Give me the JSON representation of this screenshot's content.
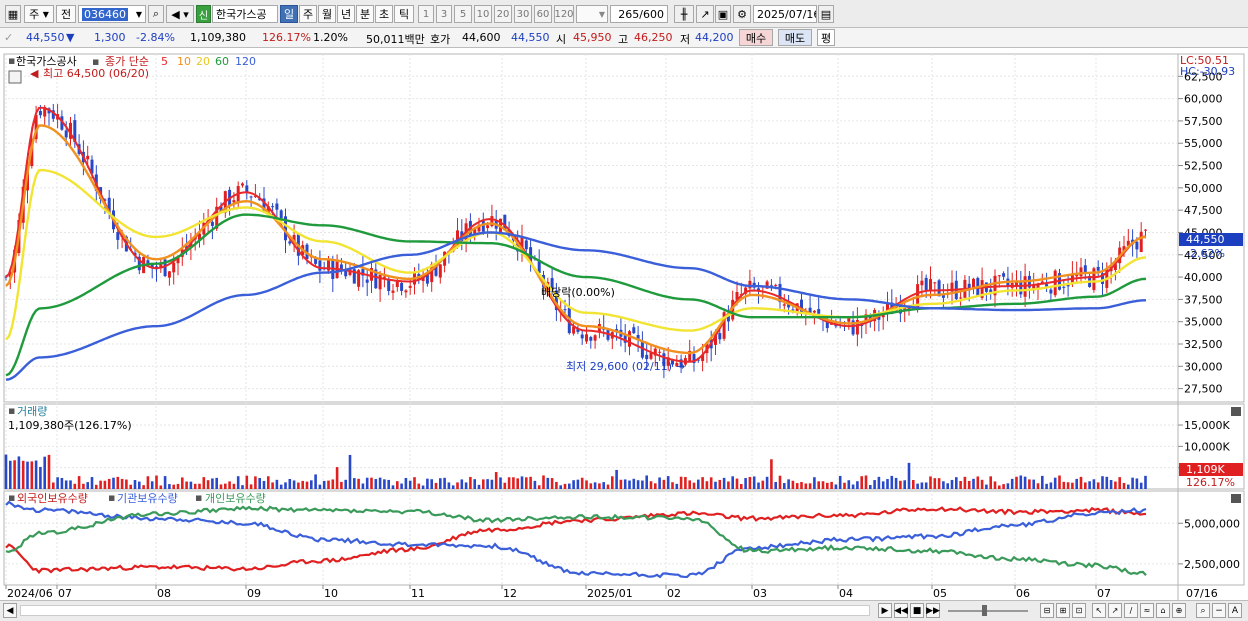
{
  "toolbar": {
    "period_type": "주",
    "prev_label": "전",
    "stock_code": "036460",
    "new_badge": "신",
    "stock_name_field": "한국가스공",
    "periods": [
      "일",
      "주",
      "월",
      "년",
      "분",
      "초",
      "틱"
    ],
    "active_period": "일",
    "intervals": [
      "1",
      "3",
      "5",
      "10",
      "20",
      "30",
      "60",
      "120"
    ],
    "count_current": "265",
    "count_total": "/600",
    "date": "2025/07/16"
  },
  "quote": {
    "price": "44,550",
    "change_arrow": "▼",
    "change": "1,300",
    "change_pct": "-2.84%",
    "volume": "1,109,380",
    "volume_ratio": "126.17%",
    "turnover_pct": "1.20%",
    "trade_value": "50,011백만",
    "ask_label": "호가",
    "ask": "44,600",
    "bid": "44,550",
    "open_label": "시",
    "open": "45,950",
    "high_label": "고",
    "high": "46,250",
    "low_label": "저",
    "low": "44,200",
    "buy_label": "매수",
    "sell_label": "매도",
    "eval_label": "평"
  },
  "price_panel": {
    "name": "한국가스공사",
    "ma_title": "종가 단순",
    "ma_periods": [
      "5",
      "10",
      "20",
      "60",
      "120"
    ],
    "high_marker": "최고 64,500 (06/20)",
    "low_marker": "최저 29,600 (02/11)",
    "dividend_marker": "배당락(0.00%)",
    "lc_label": "LC:50.51",
    "hc_label": "HC:-30.93",
    "current_price_tag": "44,550",
    "current_change_tag": "-2.62%",
    "y_ticks": [
      "62,500",
      "60,000",
      "57,500",
      "55,000",
      "52,500",
      "50,000",
      "47,500",
      "45,000",
      "42,500",
      "40,000",
      "37,500",
      "35,000",
      "32,500",
      "30,000",
      "27,500"
    ]
  },
  "volume_panel": {
    "title": "거래량",
    "current_label": "1,109,380주(126.17%)",
    "y_ticks": [
      "15,000K",
      "10,000K",
      "5,000K"
    ],
    "current_tag": "1,109K",
    "current_pct_tag": "126.17%"
  },
  "holdings_panel": {
    "legends": [
      "외국인보유수량",
      "기관보유수량",
      "개인보유수량"
    ],
    "y_ticks": [
      "5,000,000",
      "2,500,000"
    ]
  },
  "x_axis": {
    "labels": [
      "2024/06",
      "07",
      "08",
      "09",
      "10",
      "11",
      "12",
      "2025/01",
      "02",
      "03",
      "04",
      "05",
      "06",
      "07"
    ],
    "right_label": "07/16"
  },
  "colors": {
    "ma5": "#e8282a",
    "ma10": "#f0901e",
    "ma20": "#f2e432",
    "ma60": "#1f9a3c",
    "ma120": "#3a5fd9",
    "up": "#e02020",
    "down": "#2848c8",
    "foreign": "#e02020",
    "institution": "#3a5fd9",
    "individual": "#3a9a5a"
  },
  "chart_data": {
    "type": "line",
    "title": "한국가스공사",
    "x": [
      "2024/06",
      "07",
      "08",
      "09",
      "10",
      "11",
      "12",
      "2025/01",
      "02",
      "03",
      "04",
      "05",
      "06",
      "07",
      "07/16"
    ],
    "series": [
      {
        "name": "5",
        "values": [
          40000,
          59000,
          41000,
          49500,
          41000,
          39500,
          46500,
          34000,
          30500,
          38500,
          34500,
          38500,
          39000,
          40000,
          44550
        ]
      },
      {
        "name": "10",
        "values": [
          39000,
          57000,
          42000,
          48500,
          42000,
          39800,
          46000,
          34500,
          31500,
          38000,
          34800,
          38000,
          39500,
          40500,
          44500
        ]
      },
      {
        "name": "20",
        "values": [
          33000,
          52000,
          44500,
          47800,
          44000,
          40500,
          45000,
          36000,
          34000,
          36500,
          35500,
          37000,
          38500,
          39500,
          42200
        ]
      },
      {
        "name": "60",
        "values": [
          29000,
          36500,
          41500,
          47000,
          45800,
          44000,
          43800,
          40000,
          37500,
          35500,
          35500,
          36500,
          37000,
          37800,
          39800
        ]
      },
      {
        "name": "120",
        "values": [
          28500,
          31000,
          34500,
          38000,
          40500,
          42500,
          45000,
          43000,
          41000,
          39000,
          37500,
          36500,
          36300,
          36500,
          37400
        ]
      }
    ],
    "ylim": [
      26000,
      65000
    ]
  }
}
